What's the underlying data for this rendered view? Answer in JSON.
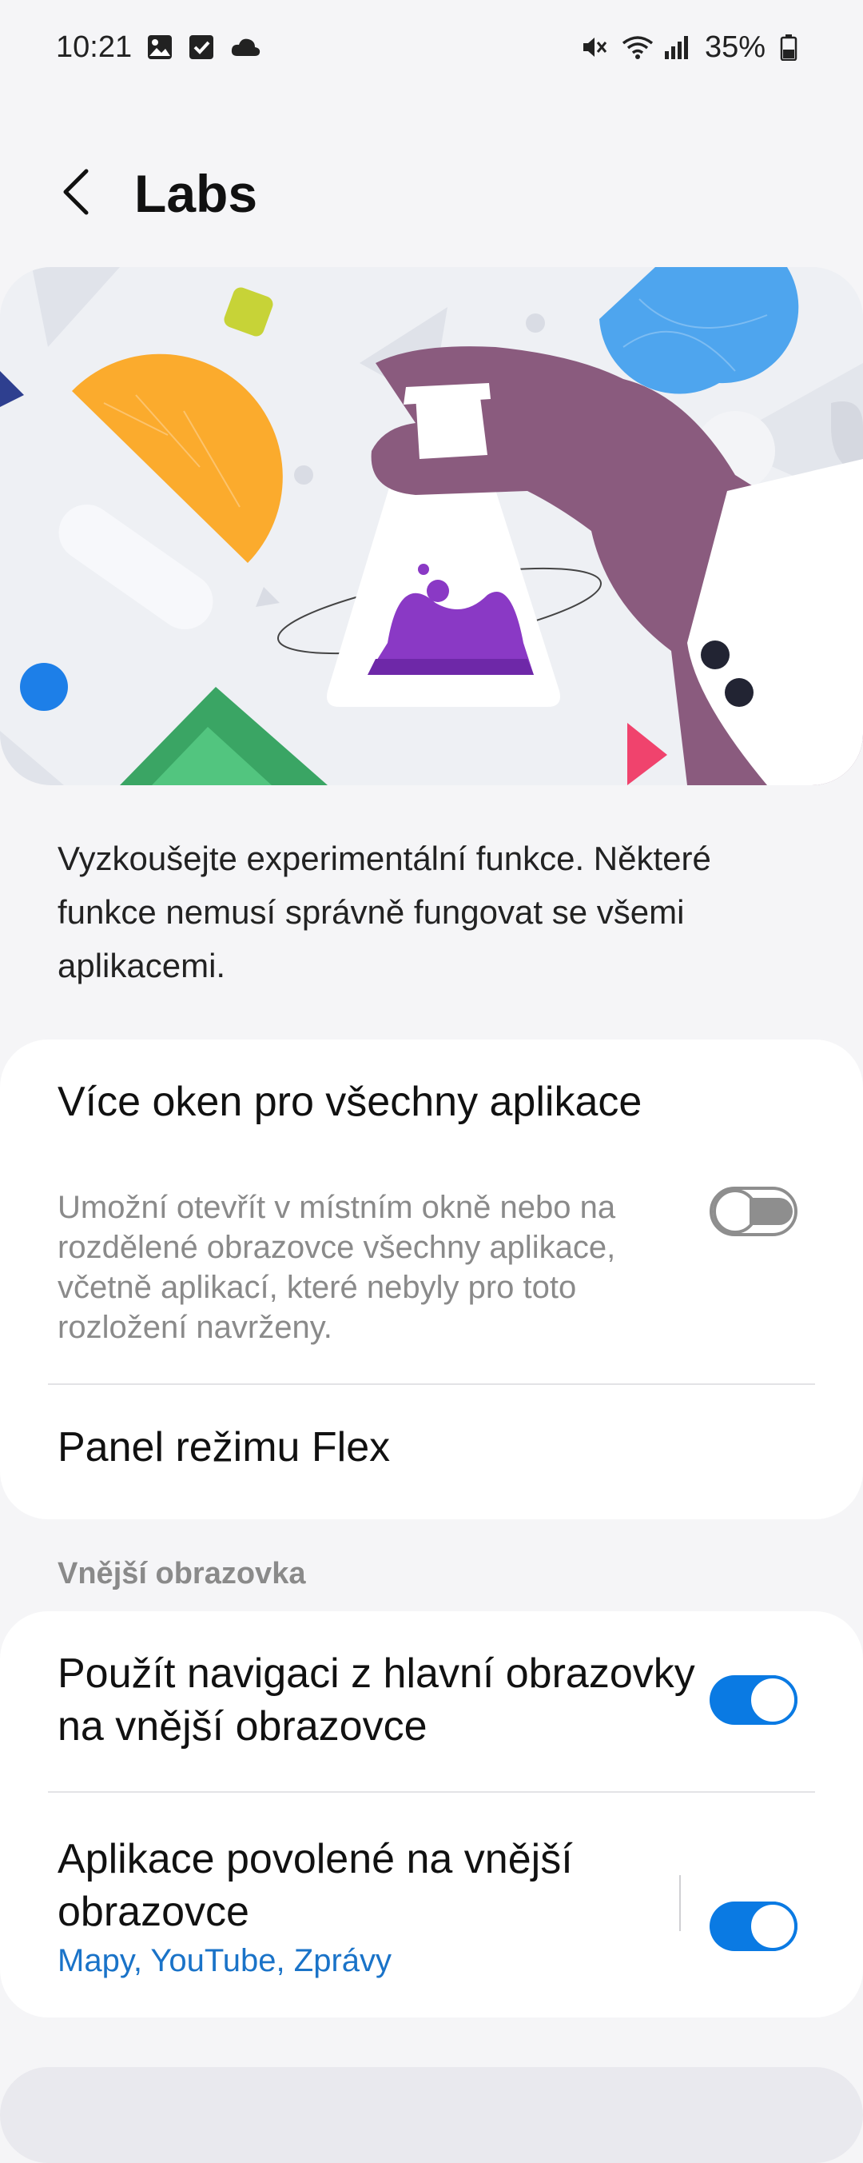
{
  "status_bar": {
    "time": "10:21",
    "left_icons": [
      "gallery-icon",
      "checkbox-icon",
      "cloud-icon"
    ],
    "right_icons": [
      "mute-icon",
      "wifi-icon",
      "signal-icon",
      "battery-icon"
    ],
    "battery": "35%"
  },
  "app_bar": {
    "title": "Labs",
    "back_icon": "back-arrow-icon"
  },
  "description": "Vyzkoušejte experimentální funkce. Některé funkce nemusí správně fungovat se všemi aplikacemi.",
  "settings": {
    "multi_window": {
      "title": "Více oken pro všechny aplikace",
      "subtitle": "Umožní otevřít v místním okně nebo na rozdělené obrazovce všechny aplikace, včetně aplikací, které nebyly pro toto rozložení navrženy.",
      "enabled": false
    },
    "flex_panel": {
      "title": "Panel režimu Flex"
    },
    "section_title": "Vnější obrazovka",
    "main_nav": {
      "title": "Použít navigaci z hlavní obrazovky na vnější obrazovce",
      "enabled": true
    },
    "allowed_apps": {
      "title": "Aplikace povolené na vnější obrazovce",
      "apps": "Mapy, YouTube, Zprávy",
      "enabled": true
    }
  },
  "colors": {
    "accent": "#0a7ae3",
    "link": "#1a73c8"
  }
}
